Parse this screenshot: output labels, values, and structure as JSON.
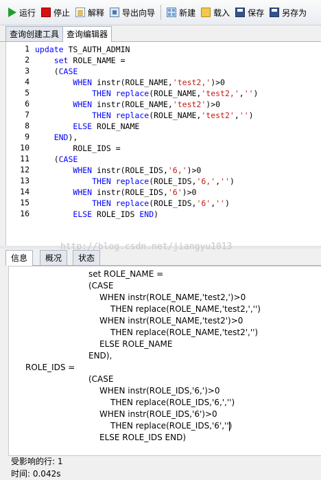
{
  "toolbar": {
    "run": "运行",
    "stop": "停止",
    "explain": "解释",
    "export_wizard": "导出向导",
    "new": "新建",
    "load": "载入",
    "save": "保存",
    "save_as": "另存为"
  },
  "tabs": {
    "query_builder": "查询创建工具",
    "query_editor": "查询编辑器"
  },
  "editor": {
    "line_numbers": [
      "1",
      "2",
      "3",
      "4",
      "5",
      "6",
      "7",
      "8",
      "9",
      "10",
      "11",
      "12",
      "13",
      "14",
      "15",
      "16"
    ],
    "lines": [
      [
        {
          "t": "update",
          "c": "kw"
        },
        {
          "t": " TS_AUTH_ADMIN",
          "c": ""
        }
      ],
      [
        {
          "t": "    ",
          "c": ""
        },
        {
          "t": "set",
          "c": "kw"
        },
        {
          "t": " ROLE_NAME =",
          "c": ""
        }
      ],
      [
        {
          "t": "    (",
          "c": ""
        },
        {
          "t": "CASE",
          "c": "kw"
        }
      ],
      [
        {
          "t": "        ",
          "c": ""
        },
        {
          "t": "WHEN",
          "c": "kw"
        },
        {
          "t": " instr(ROLE_NAME,",
          "c": ""
        },
        {
          "t": "'test2,'",
          "c": "str"
        },
        {
          "t": ")>0",
          "c": ""
        }
      ],
      [
        {
          "t": "            ",
          "c": ""
        },
        {
          "t": "THEN replace",
          "c": "kw"
        },
        {
          "t": "(ROLE_NAME,",
          "c": ""
        },
        {
          "t": "'test2,'",
          "c": "str"
        },
        {
          "t": ",",
          "c": ""
        },
        {
          "t": "''",
          "c": "str"
        },
        {
          "t": ")",
          "c": ""
        }
      ],
      [
        {
          "t": "        ",
          "c": ""
        },
        {
          "t": "WHEN",
          "c": "kw"
        },
        {
          "t": " instr(ROLE_NAME,",
          "c": ""
        },
        {
          "t": "'test2'",
          "c": "str"
        },
        {
          "t": ")>0",
          "c": ""
        }
      ],
      [
        {
          "t": "            ",
          "c": ""
        },
        {
          "t": "THEN replace",
          "c": "kw"
        },
        {
          "t": "(ROLE_NAME,",
          "c": ""
        },
        {
          "t": "'test2'",
          "c": "str"
        },
        {
          "t": ",",
          "c": ""
        },
        {
          "t": "''",
          "c": "str"
        },
        {
          "t": ")",
          "c": ""
        }
      ],
      [
        {
          "t": "        ",
          "c": ""
        },
        {
          "t": "ELSE",
          "c": "kw"
        },
        {
          "t": " ROLE_NAME",
          "c": ""
        }
      ],
      [
        {
          "t": "    ",
          "c": ""
        },
        {
          "t": "END",
          "c": "kw"
        },
        {
          "t": "),",
          "c": ""
        }
      ],
      [
        {
          "t": "        ROLE_IDS =",
          "c": ""
        }
      ],
      [
        {
          "t": "    (",
          "c": ""
        },
        {
          "t": "CASE",
          "c": "kw"
        }
      ],
      [
        {
          "t": "        ",
          "c": ""
        },
        {
          "t": "WHEN",
          "c": "kw"
        },
        {
          "t": " instr(ROLE_IDS,",
          "c": ""
        },
        {
          "t": "'6,'",
          "c": "str"
        },
        {
          "t": ")>0",
          "c": ""
        }
      ],
      [
        {
          "t": "            ",
          "c": ""
        },
        {
          "t": "THEN replace",
          "c": "kw"
        },
        {
          "t": "(ROLE_IDS,",
          "c": ""
        },
        {
          "t": "'6,'",
          "c": "str"
        },
        {
          "t": ",",
          "c": ""
        },
        {
          "t": "''",
          "c": "str"
        },
        {
          "t": ")",
          "c": ""
        }
      ],
      [
        {
          "t": "        ",
          "c": ""
        },
        {
          "t": "WHEN",
          "c": "kw"
        },
        {
          "t": " instr(ROLE_IDS,",
          "c": ""
        },
        {
          "t": "'6'",
          "c": "str"
        },
        {
          "t": ")>0",
          "c": ""
        }
      ],
      [
        {
          "t": "            ",
          "c": ""
        },
        {
          "t": "THEN replace",
          "c": "kw"
        },
        {
          "t": "(ROLE_IDS,",
          "c": ""
        },
        {
          "t": "'6'",
          "c": "str"
        },
        {
          "t": ",",
          "c": ""
        },
        {
          "t": "''",
          "c": "str"
        },
        {
          "t": ")",
          "c": ""
        }
      ],
      [
        {
          "t": "        ",
          "c": ""
        },
        {
          "t": "ELSE",
          "c": "kw"
        },
        {
          "t": " ROLE_IDS ",
          "c": ""
        },
        {
          "t": "END",
          "c": "kw"
        },
        {
          "t": ")",
          "c": ""
        }
      ]
    ]
  },
  "watermark": "http://blog.csdn.net/jiangyu1013",
  "bottom_tabs": {
    "info": "信息",
    "overview": "概况",
    "status": "状态"
  },
  "result": {
    "lines": [
      "set ROLE_NAME =",
      "(CASE",
      "WHEN instr(ROLE_NAME,'test2,')>0",
      "THEN replace(ROLE_NAME,'test2,','')",
      "WHEN instr(ROLE_NAME,'test2')>0",
      "THEN replace(ROLE_NAME,'test2','')",
      "ELSE ROLE_NAME",
      "END),",
      "ROLE_IDS =",
      "(CASE",
      "WHEN instr(ROLE_IDS,'6,')>0",
      "THEN replace(ROLE_IDS,'6,','')",
      "WHEN instr(ROLE_IDS,'6')>0",
      "THEN replace(ROLE_IDS,'6','')",
      "ELSE ROLE_IDS END)"
    ],
    "affected_rows": "受影响的行: 1",
    "time": "时间: 0.042s"
  },
  "colors": {
    "keyword": "#0000ff",
    "string": "#c41a16"
  }
}
